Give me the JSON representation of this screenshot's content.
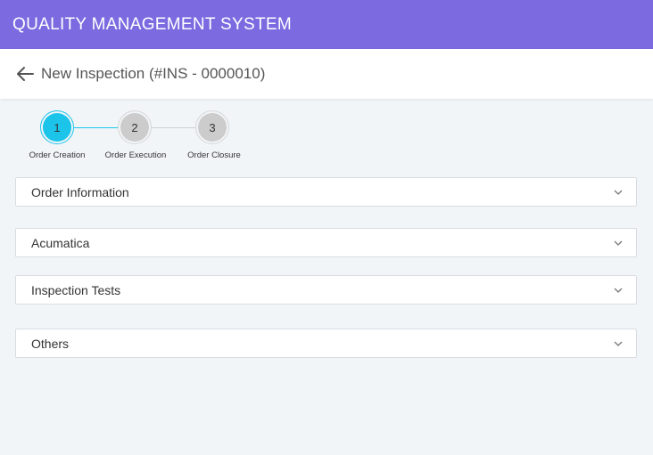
{
  "app": {
    "title": "QUALITY MANAGEMENT SYSTEM"
  },
  "header": {
    "title": "New Inspection (#INS - 0000010)",
    "back_icon": "arrow-left-icon"
  },
  "stepper": {
    "steps": [
      {
        "number": "1",
        "label": "Order Creation",
        "state": "active"
      },
      {
        "number": "2",
        "label": "Order Execution",
        "state": "inactive"
      },
      {
        "number": "3",
        "label": "Order Closure",
        "state": "inactive"
      }
    ]
  },
  "sections": [
    {
      "label": "Order Information",
      "icon": "chevron-down-icon"
    },
    {
      "label": "Acumatica",
      "icon": "chevron-down-icon"
    },
    {
      "label": "Inspection Tests",
      "icon": "chevron-down-icon"
    },
    {
      "label": "Others",
      "icon": "chevron-down-icon"
    }
  ],
  "colors": {
    "topbar": "#7b6ae0",
    "active_step": "#1cc4ea",
    "inactive_step": "#cccccc",
    "background": "#f2f5f8"
  }
}
